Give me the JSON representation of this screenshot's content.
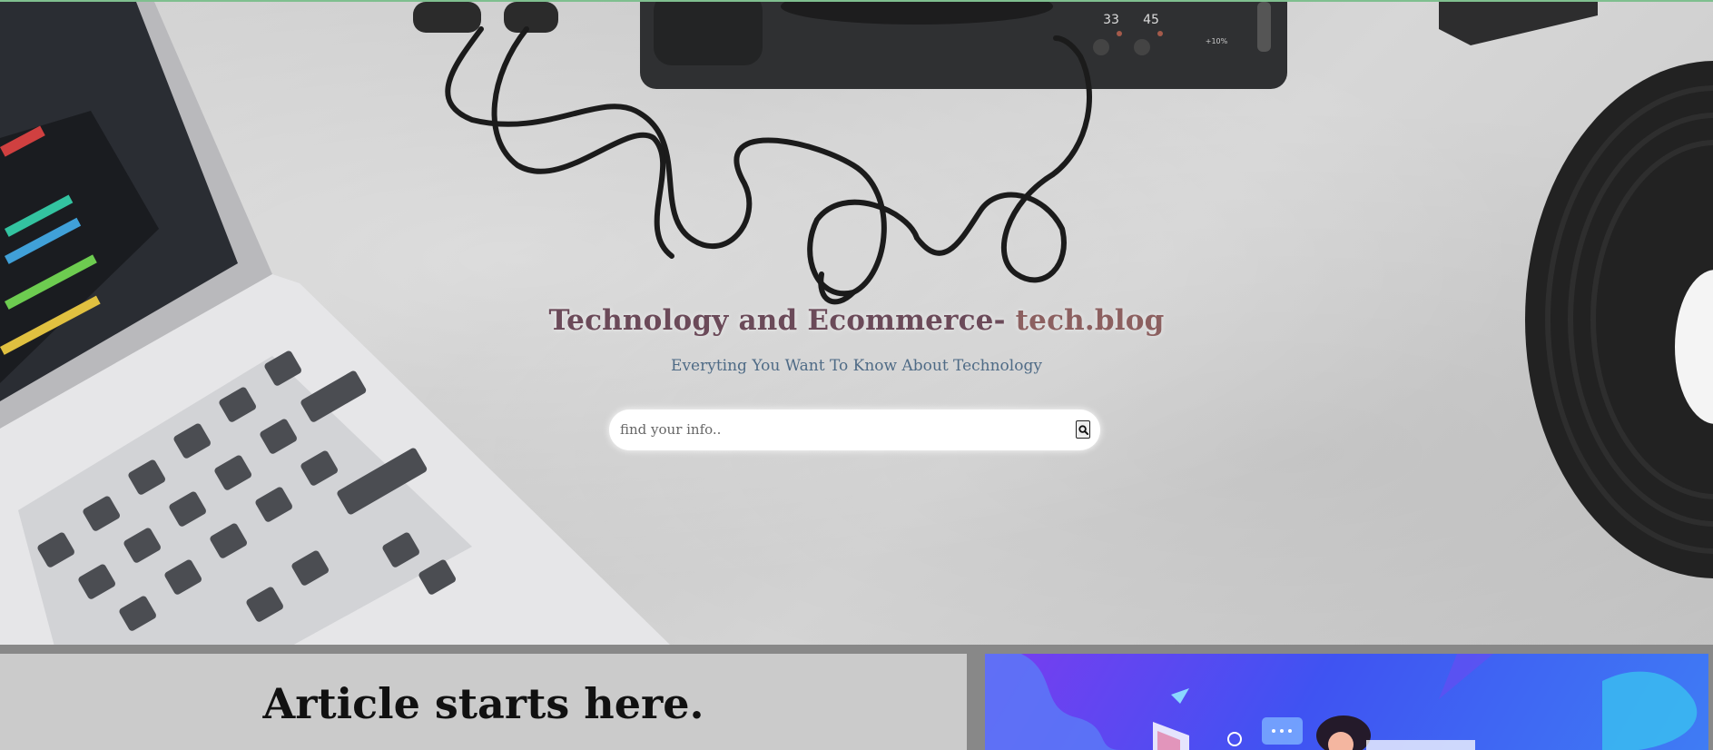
{
  "hero": {
    "title_main": "Technology and Ecommerce- ",
    "title_accent": "tech.blog",
    "subtitle": "Everyting You Want To Know About Technology",
    "search": {
      "placeholder": "find your info..",
      "button_icon": "search-icon"
    },
    "turntable_labels": [
      "33",
      "45"
    ],
    "pitch_label": "+10%"
  },
  "content": {
    "article_heading": "Article starts here."
  },
  "colors": {
    "title": "#6b4a59",
    "title_accent": "#8c6060",
    "subtitle": "#4f6b86",
    "panel": "#cbcbcb",
    "gutter": "#888888"
  }
}
